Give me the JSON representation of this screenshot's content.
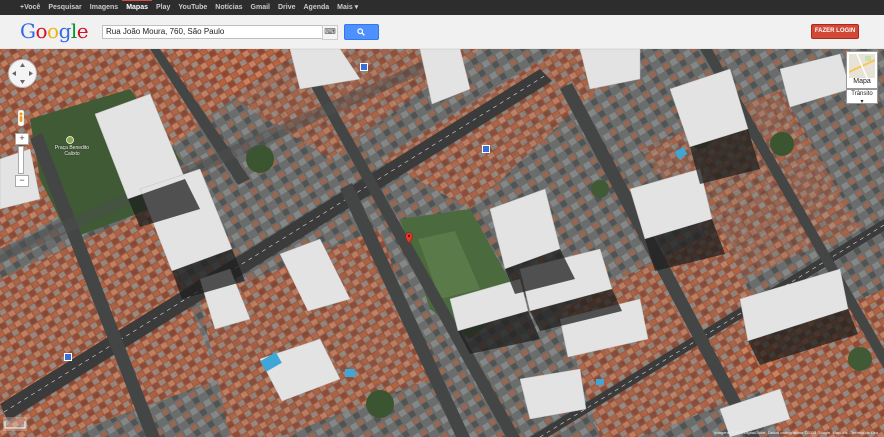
{
  "topbar": {
    "items": [
      "+Você",
      "Pesquisar",
      "Imagens",
      "Mapas",
      "Play",
      "YouTube",
      "Notícias",
      "Gmail",
      "Drive",
      "Agenda",
      "Mais ▾"
    ],
    "active_index": 3
  },
  "header": {
    "logo_letters": [
      "G",
      "o",
      "o",
      "g",
      "l",
      "e"
    ],
    "logo_colors": [
      "#3369e8",
      "#d50f25",
      "#eeb211",
      "#3369e8",
      "#009925",
      "#d50f25"
    ],
    "search_value": "Rua João Moura, 760, São Paulo",
    "login_label": "FAZER LOGIN"
  },
  "map": {
    "map_type_label": "Mapa",
    "transit_label": "Trânsito",
    "poi_label": "Praça Benedito Calixto",
    "attribution": "Imagens ©2013 DigitalGlobe, Dados cartográficos ©2013 Google, MapLink - Termos de Uso",
    "accent_colors": {
      "water": "#3ea7d8",
      "marker": "#e03a2f",
      "icon": "#3a6fd8"
    }
  }
}
